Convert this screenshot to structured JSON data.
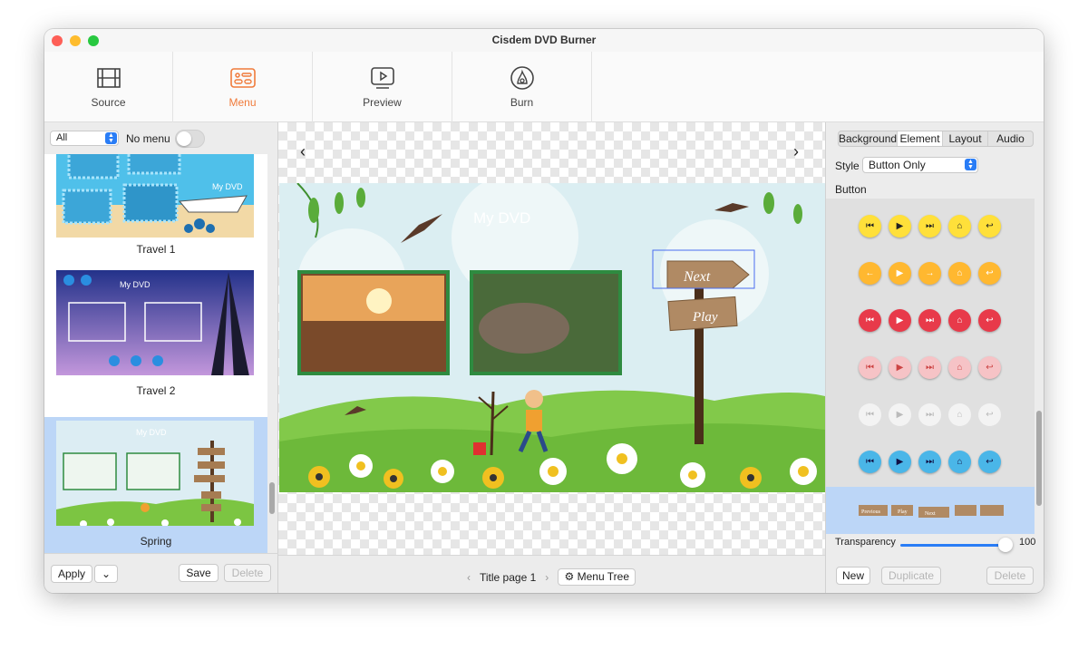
{
  "window": {
    "title": "Cisdem DVD Burner"
  },
  "toolbar": {
    "tabs": [
      {
        "label": "Source"
      },
      {
        "label": "Menu"
      },
      {
        "label": "Preview"
      },
      {
        "label": "Burn"
      }
    ],
    "active": "Menu",
    "accent": "#f07a3a"
  },
  "left_panel": {
    "filter": "All",
    "no_menu_label": "No menu",
    "templates": [
      {
        "name": "Travel 1",
        "title": "My DVD"
      },
      {
        "name": "Travel 2",
        "title": "My DVD"
      },
      {
        "name": "Spring",
        "title": "My DVD",
        "buttons": [
          "Next",
          "Play",
          "Previous"
        ]
      }
    ],
    "selected": "Spring",
    "apply_label": "Apply",
    "save_label": "Save",
    "delete_label": "Delete"
  },
  "canvas": {
    "title": "My DVD",
    "next_label": "Next",
    "play_label": "Play",
    "page_label": "Title page 1",
    "menu_tree_label": "Menu Tree"
  },
  "right_panel": {
    "tabs": [
      "Background",
      "Element",
      "Layout",
      "Audio"
    ],
    "active_tab": "Element",
    "style_label": "Style",
    "style_value": "Button Only",
    "button_label": "Button",
    "preview_buttons": [
      "Previous",
      "Play",
      "Next"
    ],
    "transparency_label": "Transparency",
    "transparency_value": "100",
    "new_label": "New",
    "duplicate_label": "Duplicate",
    "delete_label": "Delete"
  }
}
